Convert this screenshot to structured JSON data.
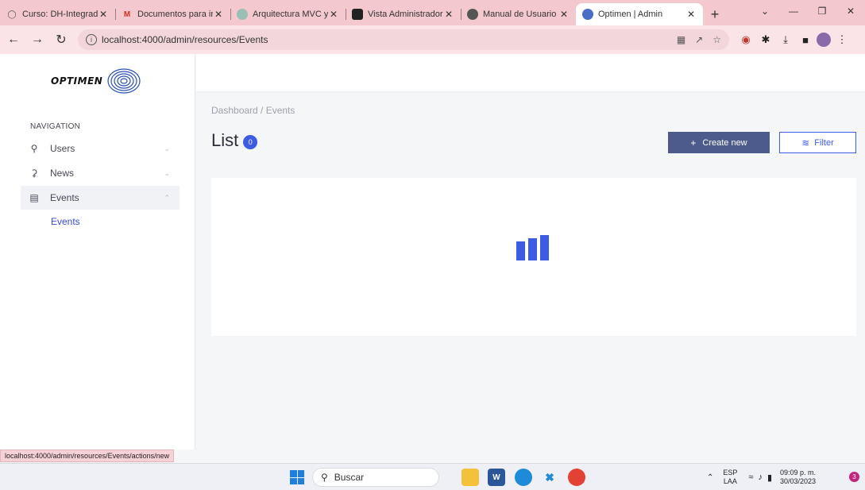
{
  "browser": {
    "tabs": [
      {
        "label": "Curso: DH-Integrador",
        "icon": "document-icon"
      },
      {
        "label": "Documentos para inte",
        "icon": "gmail-icon"
      },
      {
        "label": "Arquitectura MVC y c",
        "icon": "chat-icon"
      },
      {
        "label": "Vista Administrador e",
        "icon": "slides-icon"
      },
      {
        "label": "Manual de Usuario de",
        "icon": "globe-icon"
      },
      {
        "label": "Optimen | Admin",
        "icon": "optimen-icon",
        "active": true
      }
    ],
    "url": "localhost:4000/admin/resources/Events",
    "hover_url": "localhost:4000/admin/resources/Events/actions/new"
  },
  "sidebar": {
    "logo_text": "OPTIMEN",
    "heading": "NAVIGATION",
    "items": [
      {
        "label": "Users",
        "icon": "user-icon"
      },
      {
        "label": "News",
        "icon": "news-icon"
      },
      {
        "label": "Events",
        "icon": "events-icon"
      }
    ],
    "subitem": "Events"
  },
  "main": {
    "breadcrumb": "Dashboard / Events",
    "title": "List",
    "count": "0",
    "create_label": "Create new",
    "filter_label": "Filter"
  },
  "taskbar": {
    "search_placeholder": "Buscar",
    "lang_top": "ESP",
    "lang_bottom": "LAA",
    "time": "09:09 p. m.",
    "date": "30/03/2023",
    "notifications": "3"
  },
  "colors": {
    "accent": "#3d5be3",
    "create_button": "#4c5b8c",
    "tabstrip": "#f4c8cf"
  }
}
